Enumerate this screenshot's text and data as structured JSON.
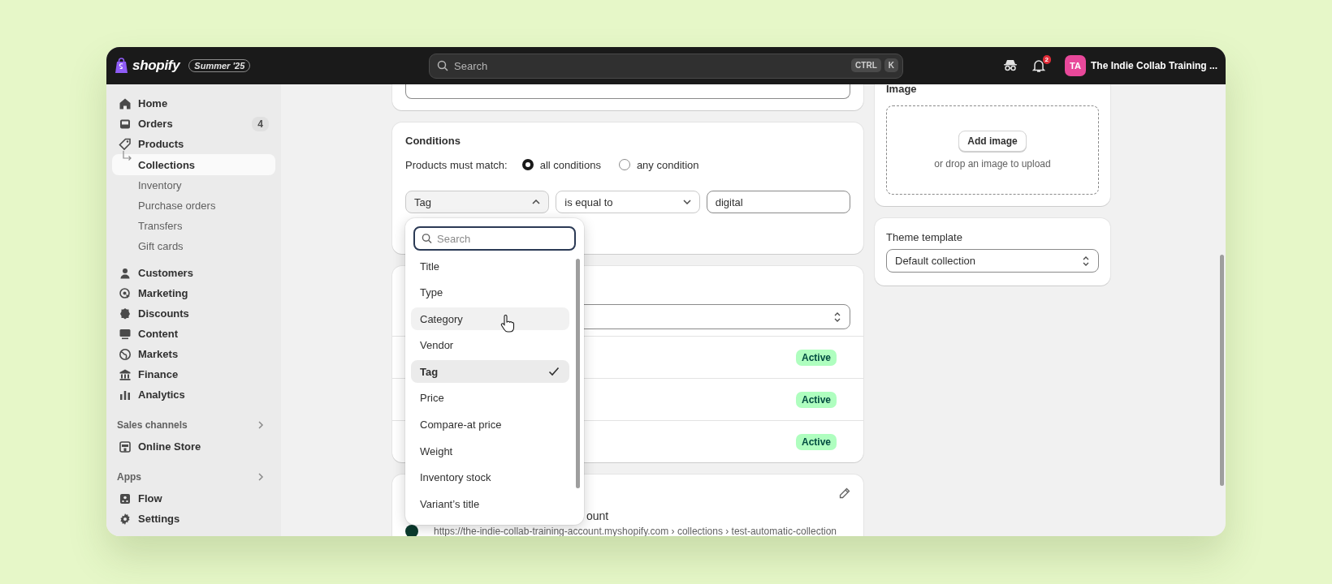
{
  "topbar": {
    "logo_text": "shopify",
    "edition": "Summer '25",
    "search": {
      "placeholder": "Search",
      "shortcut": [
        "CTRL",
        "K"
      ]
    },
    "notification_count": "2",
    "store": {
      "initials": "TA",
      "name": "The Indie Collab Training ..."
    }
  },
  "sidebar": {
    "items": [
      {
        "label": "Home",
        "kind": "nav",
        "selected": false
      },
      {
        "label": "Orders",
        "kind": "nav",
        "selected": false,
        "badge": "4"
      },
      {
        "label": "Products",
        "kind": "nav",
        "selected": false
      },
      {
        "label": "Collections",
        "kind": "sub",
        "selected": true
      },
      {
        "label": "Inventory",
        "kind": "sub",
        "selected": false
      },
      {
        "label": "Purchase orders",
        "kind": "sub",
        "selected": false
      },
      {
        "label": "Transfers",
        "kind": "sub",
        "selected": false
      },
      {
        "label": "Gift cards",
        "kind": "sub",
        "selected": false
      },
      {
        "label": "Customers",
        "kind": "nav",
        "selected": false
      },
      {
        "label": "Marketing",
        "kind": "nav",
        "selected": false
      },
      {
        "label": "Discounts",
        "kind": "nav",
        "selected": false
      },
      {
        "label": "Content",
        "kind": "nav",
        "selected": false
      },
      {
        "label": "Markets",
        "kind": "nav",
        "selected": false
      },
      {
        "label": "Finance",
        "kind": "nav",
        "selected": false
      },
      {
        "label": "Analytics",
        "kind": "nav",
        "selected": false
      },
      {
        "label": "Sales channels",
        "kind": "heading"
      },
      {
        "label": "Online Store",
        "kind": "nav",
        "selected": false
      },
      {
        "label": "Apps",
        "kind": "heading"
      },
      {
        "label": "Flow",
        "kind": "nav",
        "selected": false
      },
      {
        "label": "Settings",
        "kind": "nav",
        "selected": false
      }
    ]
  },
  "conditions": {
    "title": "Conditions",
    "match_label": "Products must match:",
    "options": [
      {
        "label": "all conditions",
        "selected": true
      },
      {
        "label": "any condition",
        "selected": false
      }
    ],
    "rule": {
      "field": "Tag",
      "expanded": true,
      "operator": "is equal to",
      "value": "digital"
    }
  },
  "field_menu": {
    "search_placeholder": "Search",
    "options": [
      {
        "label": "Title",
        "selected": false,
        "hovered": false
      },
      {
        "label": "Type",
        "selected": false,
        "hovered": false
      },
      {
        "label": "Category",
        "selected": false,
        "hovered": true
      },
      {
        "label": "Vendor",
        "selected": false,
        "hovered": false
      },
      {
        "label": "Tag",
        "selected": true,
        "hovered": false
      },
      {
        "label": "Price",
        "selected": false,
        "hovered": false
      },
      {
        "label": "Compare-at price",
        "selected": false,
        "hovered": false
      },
      {
        "label": "Weight",
        "selected": false,
        "hovered": false
      },
      {
        "label": "Inventory stock",
        "selected": false,
        "hovered": false
      },
      {
        "label": "Variant’s title",
        "selected": false,
        "hovered": false
      }
    ]
  },
  "products": {
    "rows": [
      {
        "status": "Active"
      },
      {
        "status": "Active"
      },
      {
        "status": "Active"
      }
    ]
  },
  "search_preview": {
    "title_fragment": "ount",
    "url": "https://the-indie-collab-training-account.myshopify.com › collections › test-automatic-collection"
  },
  "image": {
    "title": "Image",
    "button": "Add image",
    "hint": "or drop an image to upload"
  },
  "theme_template": {
    "label": "Theme template",
    "value": "Default collection"
  }
}
